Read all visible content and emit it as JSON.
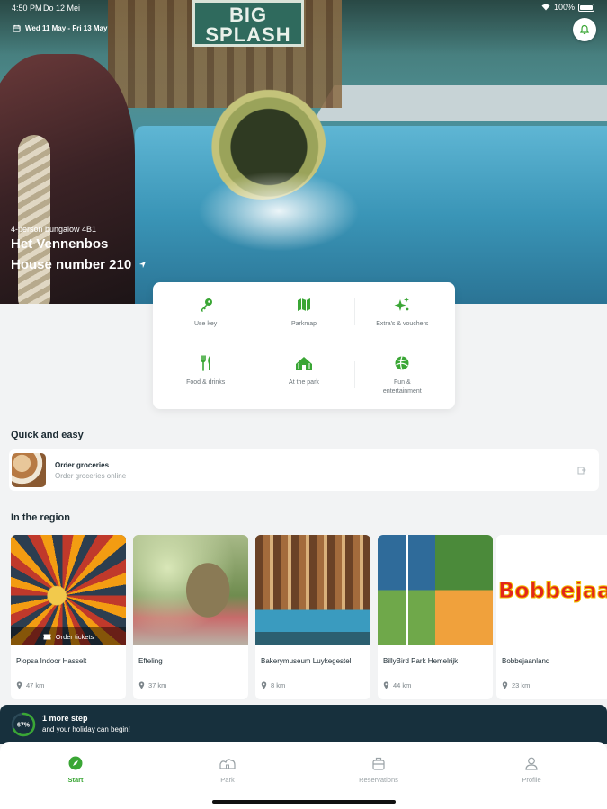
{
  "status_bar": {
    "time": "4:50 PM",
    "date": "Do 12 Mei",
    "battery": "100%"
  },
  "stay": {
    "dates": "Wed 11 May - Fri 13 May"
  },
  "hero": {
    "sign_text": "BIG SPLASH",
    "accommodation_type": "4-person bungalow 4B1",
    "park_name": "Het Vennenbos",
    "house_number": "House number 210"
  },
  "actions": [
    {
      "label": "Use key",
      "icon": "key-icon"
    },
    {
      "label": "Parkmap",
      "icon": "map-icon"
    },
    {
      "label": "Extra's & vouchers",
      "icon": "sparkle-icon"
    },
    {
      "label": "Food & drinks",
      "icon": "cutlery-icon"
    },
    {
      "label": "At the park",
      "icon": "park-home-icon"
    },
    {
      "label": "Fun & entertainment",
      "icon": "beach-ball-icon"
    }
  ],
  "quick": {
    "title": "Quick and easy",
    "item": {
      "title": "Order groceries",
      "subtitle": "Order groceries online"
    }
  },
  "region": {
    "title": "In the region",
    "items": [
      {
        "name": "Plopsa Indoor Hasselt",
        "distance": "47 km",
        "chip": "Order tickets"
      },
      {
        "name": "Efteling",
        "distance": "37 km"
      },
      {
        "name": "Bakerymuseum Luykegestel",
        "distance": "8 km"
      },
      {
        "name": "BillyBird Park Hemelrijk",
        "distance": "44 km"
      },
      {
        "name": "Bobbejaanland",
        "distance": "23 km",
        "logo_text": "Bobbejaanland"
      }
    ]
  },
  "progress": {
    "percent_label": "67%",
    "percent": 0.67,
    "line1": "1 more step",
    "line2": "and your holiday can begin!"
  },
  "tabs": [
    {
      "label": "Start",
      "icon": "compass-icon",
      "active": true
    },
    {
      "label": "Park",
      "icon": "park-icon",
      "active": false
    },
    {
      "label": "Reservations",
      "icon": "suitcase-icon",
      "active": false
    },
    {
      "label": "Profile",
      "icon": "profile-icon",
      "active": false
    }
  ],
  "colors": {
    "accent": "#3aa635",
    "banner": "#17303d",
    "background": "#f2f3f4"
  }
}
